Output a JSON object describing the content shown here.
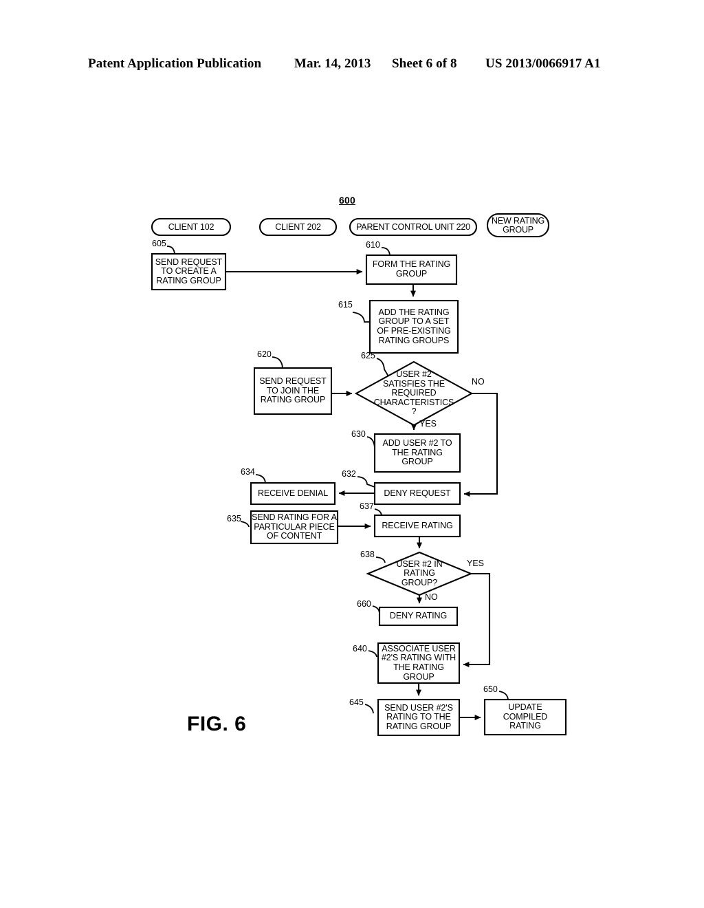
{
  "header": {
    "publication": "Patent Application Publication",
    "date": "Mar. 14, 2013",
    "sheet": "Sheet 6 of 8",
    "patent_number": "US 2013/0066917 A1"
  },
  "figure": {
    "label": "FIG. 6",
    "number": "600",
    "lanes": [
      {
        "id": "lane-client-102",
        "label": "CLIENT 102"
      },
      {
        "id": "lane-client-202",
        "label": "CLIENT 202"
      },
      {
        "id": "lane-parent-control",
        "label": "PARENT CONTROL UNIT 220"
      },
      {
        "id": "lane-new-rating-group",
        "label": "NEW RATING\nGROUP"
      }
    ],
    "nodes": [
      {
        "ref": "605",
        "type": "process",
        "label": "SEND REQUEST\nTO CREATE A\nRATING GROUP"
      },
      {
        "ref": "610",
        "type": "process",
        "label": "FORM THE RATING\nGROUP"
      },
      {
        "ref": "615",
        "type": "process",
        "label": "ADD THE RATING\nGROUP TO A SET\nOF PRE-EXISTING\nRATING GROUPS"
      },
      {
        "ref": "620",
        "type": "process",
        "label": "SEND REQUEST\nTO JOIN THE\nRATING GROUP"
      },
      {
        "ref": "625",
        "type": "decision",
        "label": "USER #2\nSATISFIES THE\nREQUIRED\nCHARACTERISTICS\n?"
      },
      {
        "ref": "630",
        "type": "process",
        "label": "ADD USER #2 TO\nTHE RATING\nGROUP"
      },
      {
        "ref": "632",
        "type": "process",
        "label": "DENY REQUEST"
      },
      {
        "ref": "634",
        "type": "process",
        "label": "RECEIVE DENIAL"
      },
      {
        "ref": "635",
        "type": "process",
        "label": "SEND RATING FOR A\nPARTICULAR PIECE\nOF CONTENT"
      },
      {
        "ref": "637",
        "type": "process",
        "label": "RECEIVE RATING"
      },
      {
        "ref": "638",
        "type": "decision",
        "label": "USER #2 IN\nRATING\nGROUP?"
      },
      {
        "ref": "660",
        "type": "process",
        "label": "DENY  RATING"
      },
      {
        "ref": "640",
        "type": "process",
        "label": "ASSOCIATE USER\n#2'S RATING WITH\nTHE RATING\nGROUP"
      },
      {
        "ref": "645",
        "type": "process",
        "label": "SEND USER #2'S\nRATING TO THE\nRATING GROUP"
      },
      {
        "ref": "650",
        "type": "process",
        "label": "UPDATE\nCOMPILED\nRATING"
      }
    ],
    "edge_labels": [
      {
        "id": "edge-625-no",
        "label": "NO"
      },
      {
        "id": "edge-625-yes",
        "label": "YES"
      },
      {
        "id": "edge-638-yes",
        "label": "YES"
      },
      {
        "id": "edge-638-no",
        "label": "NO"
      }
    ]
  }
}
